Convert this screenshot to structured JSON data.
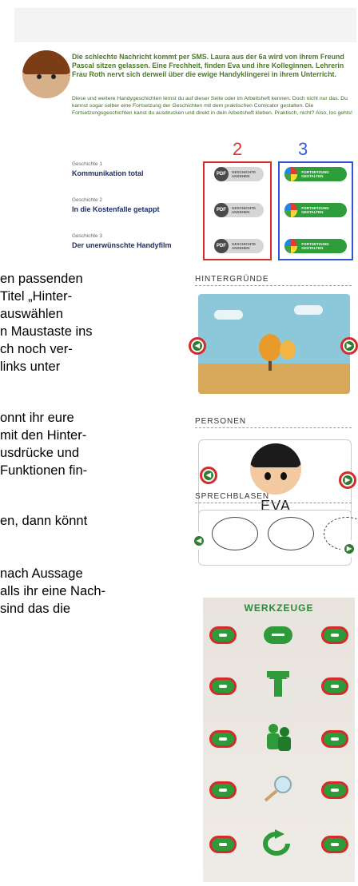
{
  "top_panel": {
    "headline": "Die schlechte Nachricht kommt per SMS. Laura aus der 6a wird von ihrem Freund Pascal sitzen gelassen. Eine Frechheit, finden Eva und ihre Kolleginnen. Lehrerin Frau Roth nervt sich derweil über die ewige Handyklingerei in ihrem Unterricht.",
    "intro": "Diese und weitere Handygeschichten lernst du auf dieser Seite oder im Arbeitsheft kennen. Doch nicht nur das. Du kannst sogar selber eine Fortsetzung der Geschichten mit dem praktischen Comicator gestalten. Die Fortsetzungsgeschichten kanst du ausdrucken und direkt in dein Arbeitsheft kleben. Praktisch, nicht? Also, los gehts!",
    "marker_2": "2",
    "marker_3": "3",
    "stories": [
      {
        "caption": "Geschichte 1",
        "title": "Kommunikation total"
      },
      {
        "caption": "Geschichte 2",
        "title": "In die Kostenfalle getappt"
      },
      {
        "caption": "Geschichte 3",
        "title": "Der unerwünschte Handyfilm"
      }
    ],
    "pdf_label": "PDF",
    "pdf_button": "GESCHICHTE ANSEHEN",
    "continue_button": "FORTSETZUNG GESTALTEN"
  },
  "body_text": [
    "en passenden",
    " Titel „Hinter-",
    "auswählen",
    "n Maustaste ins",
    "ch noch ver-",
    "links unter",
    "onnt ihr eure",
    "mit den Hinter-",
    "usdrücke und",
    "Funktionen fin-",
    "en, dann könnt",
    "nach Aussage",
    "alls ihr eine Nach-",
    "sind das die"
  ],
  "sections": {
    "backgrounds": "HINTERGRÜNDE",
    "persons": "PERSONEN",
    "person_name": "EVA",
    "bubbles": "SPRECHBLASEN",
    "tools": "WERKZEUGE"
  },
  "icons": {
    "prev": "arrow-left-icon",
    "next": "arrow-right-icon",
    "minus": "minus-icon",
    "plus": "plus-icon"
  },
  "colors": {
    "accent_green": "#2d9e3a",
    "marker_red": "#d92c2c",
    "marker_blue": "#3554d6",
    "headline_green": "#4a7a26"
  }
}
